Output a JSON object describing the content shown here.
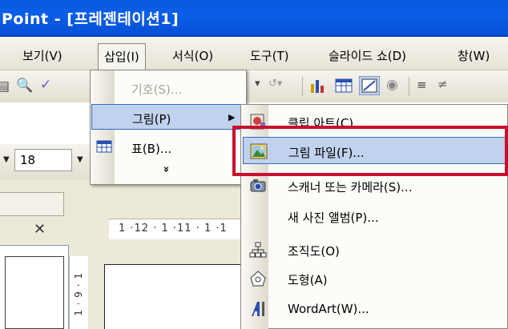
{
  "window": {
    "title": "Point - [프레젠테이션1]"
  },
  "menubar": {
    "items": [
      {
        "label": "보기(V)"
      },
      {
        "label": "삽입(I)"
      },
      {
        "label": "서식(O)"
      },
      {
        "label": "도구(T)"
      },
      {
        "label": "슬라이드 쇼(D)"
      },
      {
        "label": "창(W)"
      }
    ]
  },
  "formatting": {
    "font_size": "18"
  },
  "ruler": {
    "horizontal_text": "1 ·12 · 1 ·11 · 1 ·1",
    "vertical_text": "1 · 9 · 1"
  },
  "insert_menu": {
    "items": [
      {
        "label": "기호(S)...",
        "disabled": true
      },
      {
        "label": "그림(P)",
        "has_submenu": true,
        "highlighted": true
      },
      {
        "label": "표(B)..."
      }
    ],
    "expand_glyph": "»"
  },
  "picture_submenu": {
    "items": [
      {
        "label": "클립 아트(C)...",
        "icon": "clip-art-icon"
      },
      {
        "label": "그림 파일(F)...",
        "icon": "picture-file-icon",
        "highlighted": true
      },
      {
        "label": "스캐너 또는 카메라(S)...",
        "icon": "scanner-camera-icon"
      },
      {
        "label": "새 사진 앨범(P)...",
        "icon": ""
      },
      {
        "label": "조직도(O)",
        "icon": "org-chart-icon"
      },
      {
        "label": "도형(A)",
        "icon": "autoshape-icon"
      },
      {
        "label": "WordArt(W)...",
        "icon": "wordart-icon"
      }
    ]
  },
  "annotation": {
    "highlight_color": "#c8102e"
  }
}
